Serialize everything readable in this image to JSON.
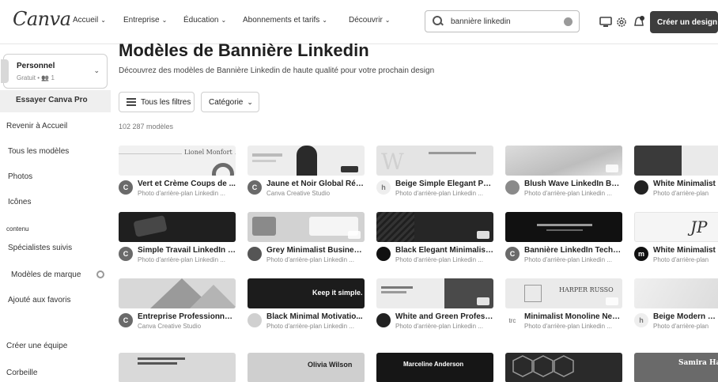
{
  "app": {
    "logo": "Canva"
  },
  "nav": [
    {
      "label": "Accueil"
    },
    {
      "label": "Entreprise"
    },
    {
      "label": "Éducation"
    },
    {
      "label": "Abonnements et tarifs"
    },
    {
      "label": "Découvrir"
    }
  ],
  "chevron": "⌄",
  "search": {
    "value": "bannière linkedin"
  },
  "header": {
    "create_label": "Créer un design"
  },
  "account": {
    "name": "Personnel",
    "sub": "Gratuit • 👥 1"
  },
  "sidebar": {
    "pro": "Essayer Canva Pro",
    "items": [
      {
        "label": "Revenir à Accueil"
      },
      {
        "label": "Tous les modèles"
      },
      {
        "label": "Photos"
      },
      {
        "label": "Icônes"
      }
    ],
    "section": "contenu",
    "items2": [
      {
        "label": "Spécialistes suivis"
      },
      {
        "label": "Modèles de marque"
      },
      {
        "label": "Ajouté aux favoris"
      }
    ],
    "team": "Créer une équipe",
    "trash": "Corbeille"
  },
  "main": {
    "title": "Modèles de Bannière Linkedin",
    "subtitle": "Découvrez des modèles de Bannière Linkedin de haute qualité pour votre prochain design",
    "filters_label": "Tous les filtres",
    "category_label": "Catégorie",
    "count": "102 287 modèles"
  },
  "cards": [
    {
      "title": "Vert et Crème Coups de ...",
      "sub": "Photo d'arrière-plan Linkedin ...",
      "avatar": "C",
      "thumb_text": "Lionel Monfort"
    },
    {
      "title": "Jaune et Noir Global Rép...",
      "sub": "Canva Creative Studio",
      "avatar": "C",
      "thumb_text": ""
    },
    {
      "title": "Beige Simple Elegant Per...",
      "sub": "Photo d'arrière-plan Linkedin ...",
      "avatar": "h",
      "thumb_text": ""
    },
    {
      "title": "Blush Wave LinkedIn Ban...",
      "sub": "Photo d'arrière-plan Linkedin ...",
      "avatar": "",
      "thumb_text": ""
    },
    {
      "title": "White Minimalist",
      "sub": "Photo d'arrière-plan",
      "avatar": "",
      "thumb_text": ""
    },
    {
      "title": "Simple Travail LinkedIn B...",
      "sub": "Photo d'arrière-plan Linkedin ...",
      "avatar": "C",
      "thumb_text": ""
    },
    {
      "title": "Grey Minimalist Business...",
      "sub": "Photo d'arrière-plan Linkedin ...",
      "avatar": "",
      "thumb_text": ""
    },
    {
      "title": "Black Elegant Minimalist ...",
      "sub": "Photo d'arrière-plan Linkedin ...",
      "avatar": "",
      "thumb_text": ""
    },
    {
      "title": "Bannière LinkedIn Techn...",
      "sub": "Photo d'arrière-plan Linkedin ...",
      "avatar": "C",
      "thumb_text": ""
    },
    {
      "title": "White Minimalist",
      "sub": "Photo d'arrière-plan",
      "avatar": "m",
      "thumb_text": ""
    },
    {
      "title": "Entreprise Professionnel ...",
      "sub": "Canva Creative Studio",
      "avatar": "C",
      "thumb_text": ""
    },
    {
      "title": "Black Minimal Motivatio...",
      "sub": "Photo d'arrière-plan Linkedin ...",
      "avatar": "",
      "thumb_text": "Keep it simple."
    },
    {
      "title": "White and Green Professi...",
      "sub": "Photo d'arrière-plan Linkedin ...",
      "avatar": "",
      "thumb_text": ""
    },
    {
      "title": "Minimalist Monoline Neu...",
      "sub": "Photo d'arrière-plan Linkedin ...",
      "avatar": "trc",
      "thumb_text": "HARPER RUSSO"
    },
    {
      "title": "Beige Modern Ele",
      "sub": "Photo d'arrière-plan",
      "avatar": "h",
      "thumb_text": ""
    },
    {
      "title": "",
      "sub": "",
      "avatar": "",
      "thumb_text": ""
    },
    {
      "title": "",
      "sub": "",
      "avatar": "",
      "thumb_text": "Olivia Wilson"
    },
    {
      "title": "",
      "sub": "",
      "avatar": "",
      "thumb_text": "Marceline Anderson"
    },
    {
      "title": "",
      "sub": "",
      "avatar": "",
      "thumb_text": ""
    },
    {
      "title": "",
      "sub": "",
      "avatar": "",
      "thumb_text": "Samira Ha"
    }
  ]
}
